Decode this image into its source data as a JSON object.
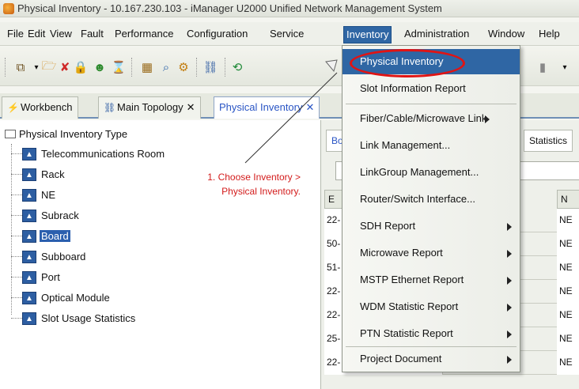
{
  "window": {
    "title": "Physical Inventory - 10.167.230.103 - iManager U2000 Unified Network Management System"
  },
  "menubar": {
    "file": "File",
    "edit": "Edit",
    "view": "View",
    "fault": "Fault",
    "performance": "Performance",
    "configuration": "Configuration",
    "service": "Service",
    "inventory": "Inventory",
    "administration": "Administration",
    "window": "Window",
    "help": "Help"
  },
  "tabs": {
    "workbench": "Workbench",
    "main_topology": "Main Topology",
    "physical_inventory": "Physical Inventory",
    "close_glyph": "✕"
  },
  "tree": {
    "root": "Physical Inventory Type",
    "nodes": [
      "Telecommunications Room",
      "Rack",
      "NE",
      "Subrack",
      "Board",
      "Subboard",
      "Port",
      "Optical Module",
      "Slot Usage Statistics"
    ],
    "selected": "Board"
  },
  "annotation": {
    "line1": "1. Choose Inventory >",
    "line2": "Physical Inventory."
  },
  "inventory_menu": {
    "items": [
      "Physical Inventory",
      "Slot Information Report",
      "Fiber/Cable/Microwave Link",
      "Link Management...",
      "LinkGroup Management...",
      "Router/Switch Interface...",
      "SDH Report",
      "Microwave Report",
      "MSTP Ethernet Report",
      "WDM Statistic Report",
      "PTN Statistic Report",
      "Project Document"
    ]
  },
  "right_pane": {
    "tab_bo": "Bo",
    "tab_statistics": "Statistics",
    "grid_head_left": "E",
    "grid_head_right": "N",
    "rows": [
      {
        "left": "22-",
        "right": "NE"
      },
      {
        "left": "50-",
        "right": "NE"
      },
      {
        "left": "51-",
        "right": "NE"
      },
      {
        "left": "22-",
        "right": "NE"
      },
      {
        "left": "22-",
        "right": "NE"
      },
      {
        "left": "25-",
        "right": "NE"
      },
      {
        "left": "22-",
        "right": "NE"
      }
    ]
  },
  "colors": {
    "highlight": "#2f66a4",
    "annotation_red": "#d31b1b",
    "tab_active_text": "#2a55c5"
  }
}
